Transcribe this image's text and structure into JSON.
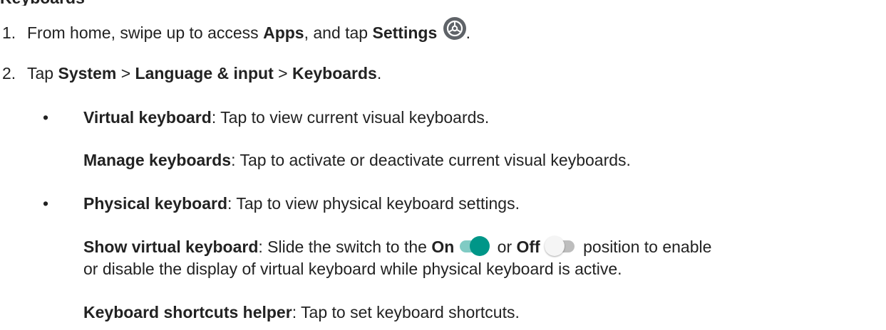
{
  "section_title_fragment": "Keyboards",
  "steps": [
    {
      "num": "1.",
      "text1": "From home, swipe up to access ",
      "bold1": "Apps",
      "text2": ", and tap ",
      "bold2": "Settings",
      "icon": "settings-gear-icon",
      "text3": "."
    },
    {
      "num": "2.",
      "text1": "Tap ",
      "bold1": "System",
      "sep1": " > ",
      "bold2": "Language & input",
      "sep2": " > ",
      "bold3": "Keyboards",
      "text2": "."
    }
  ],
  "bullets": [
    {
      "mark": "•",
      "bold": "Virtual keyboard",
      "text": ": Tap to view current visual keyboards."
    },
    {
      "mark": "•",
      "bold": "Physical keyboard",
      "text": ": Tap to view physical keyboard settings."
    }
  ],
  "subitems": {
    "manage": {
      "bold": "Manage keyboards",
      "text": ": Tap to activate or deactivate current visual keyboards."
    },
    "show_virtual": {
      "bold": "Show virtual keyboard",
      "text1": ": Slide the switch to the ",
      "on_label": "On",
      "or": " or ",
      "off_label": "Off",
      "text2": " position to enable",
      "line2": "or disable the display of virtual keyboard while physical keyboard is active."
    },
    "shortcuts": {
      "bold": "Keyboard shortcuts helper",
      "text": ": Tap to set keyboard shortcuts."
    }
  },
  "colors": {
    "switch_on_knob": "#009688",
    "switch_on_track": "#80cbc4",
    "switch_off_track": "#bdbdbd",
    "gear_icon_bg": "#5f6368"
  }
}
